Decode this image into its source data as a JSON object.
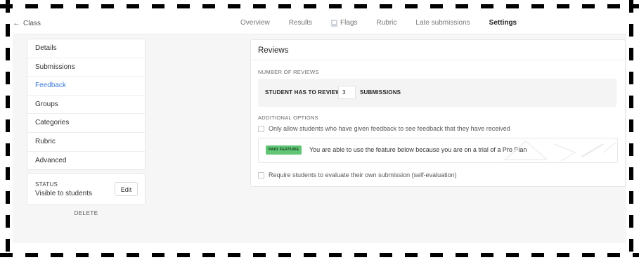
{
  "topbar": {
    "back_label": "Class",
    "tabs": [
      {
        "label": "Overview"
      },
      {
        "label": "Results"
      },
      {
        "label": "Flags"
      },
      {
        "label": "Rubric"
      },
      {
        "label": "Late submissions"
      },
      {
        "label": "Settings"
      }
    ],
    "active_tab": "Settings"
  },
  "sidebar": {
    "items": [
      {
        "label": "Details"
      },
      {
        "label": "Submissions"
      },
      {
        "label": "Feedback"
      },
      {
        "label": "Groups"
      },
      {
        "label": "Categories"
      },
      {
        "label": "Rubric"
      },
      {
        "label": "Advanced"
      }
    ],
    "active_item": "Feedback",
    "active_color": "#3b7dd8"
  },
  "status": {
    "label": "STATUS",
    "value": "Visible to students",
    "edit_label": "Edit"
  },
  "delete_label": "DELETE",
  "reviews": {
    "title": "Reviews",
    "number_label": "NUMBER OF REVIEWS",
    "review_prefix": "STUDENT HAS TO REVIEW",
    "review_count": "3",
    "review_suffix": "SUBMISSIONS",
    "additional_label": "ADDITIONAL OPTIONS",
    "option_feedback": "Only allow students who have given feedback to see feedback that they have received",
    "paid_badge": "PAID FEATURE",
    "paid_text": "You are able to use the feature below because you are on a trial of a Pro Plan",
    "option_self_eval": "Require students to evaluate their own submission (self-evaluation)",
    "badge_color": "#62c676"
  }
}
